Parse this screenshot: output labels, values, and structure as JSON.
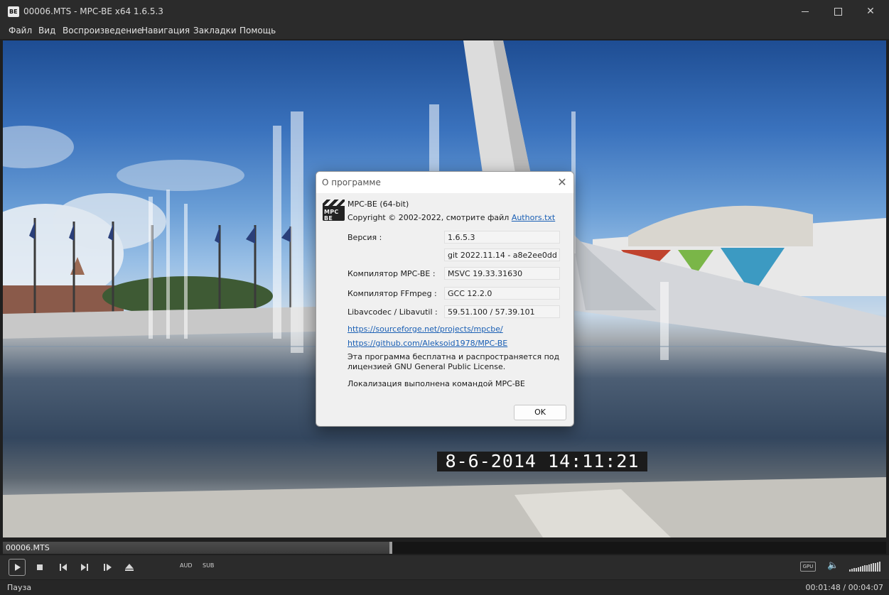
{
  "window": {
    "title": "00006.MTS - MPC-BE x64 1.6.5.3",
    "app_icon_label": "BE"
  },
  "menu": [
    "Файл",
    "Вид",
    "Воспроизведение",
    "Навигация",
    "Закладки",
    "Помощь"
  ],
  "video": {
    "timestamp": "8-6-2014  14:11:21"
  },
  "about_dialog": {
    "title": "О программе",
    "logo_label": "MPC BE",
    "product": "MPC-BE (64-bit)",
    "copyright_prefix": "Copyright © 2002-2022, смотрите файл ",
    "authors_link": "Authors.txt",
    "rows": [
      {
        "label": "Версия :",
        "value": "1.6.5.3"
      },
      {
        "label": "",
        "value": "git 2022.11.14 - a8e2ee0dd"
      },
      {
        "label": "Компилятор MPC-BE :",
        "value": "MSVC 19.33.31630"
      },
      {
        "label": "Компилятор FFmpeg :",
        "value": "GCC 12.2.0"
      },
      {
        "label": "Libavcodec / Libavutil :",
        "value": "59.51.100 / 57.39.101"
      }
    ],
    "link1": "https://sourceforge.net/projects/mpcbe/",
    "link2": "https://github.com/Aleksoid1978/MPC-BE",
    "license_line1": "Эта программа бесплатна и распространяется под",
    "license_line2": "лицензией GNU General Public License.",
    "localization": "Локализация выполнена командой MPC-BE",
    "ok_label": "OK"
  },
  "seekbar": {
    "file_label": "00006.MTS",
    "position_fraction": 0.4395
  },
  "controls": {
    "audio_label": "AUD",
    "subtitle_label": "SUB",
    "gpu_label": "GPU",
    "volume_level": 1.0
  },
  "status": {
    "state": "Пауза",
    "time": "00:01:48 / 00:04:07"
  }
}
